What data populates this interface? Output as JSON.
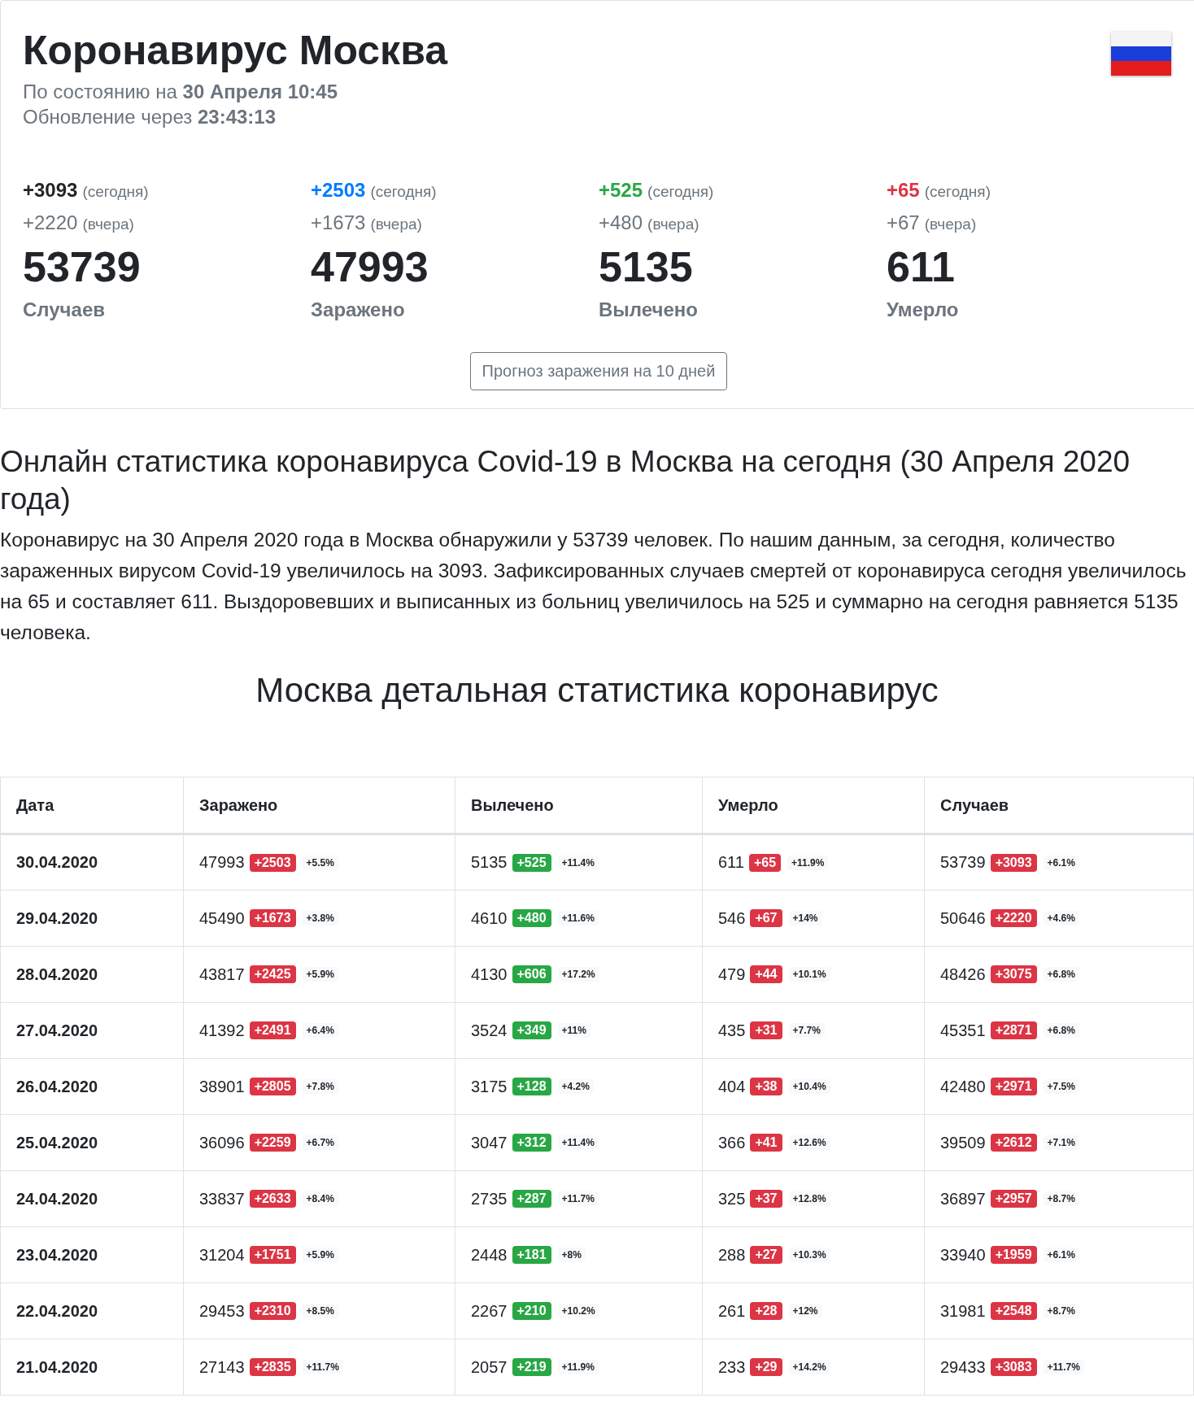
{
  "header": {
    "title": "Коронавирус Москва",
    "status": "По состоянию на **30 Апреля 10:45**",
    "update": "Обновление через **23:43:13**"
  },
  "counters": [
    {
      "today": "+3093",
      "today_note": "(сегодня)",
      "color": "#212529",
      "yesterday": "+2220",
      "yesterday_note": "(вчера)",
      "total": "53739",
      "label": "Случаев"
    },
    {
      "today": "+2503",
      "today_note": "(сегодня)",
      "color": "#007bff",
      "yesterday": "+1673",
      "yesterday_note": "(вчера)",
      "total": "47993",
      "label": "Заражено"
    },
    {
      "today": "+525",
      "today_note": "(сегодня)",
      "color": "#28a745",
      "yesterday": "+480",
      "yesterday_note": "(вчера)",
      "total": "5135",
      "label": "Вылечено"
    },
    {
      "today": "+65",
      "today_note": "(сегодня)",
      "color": "#dc3545",
      "yesterday": "+67",
      "yesterday_note": "(вчера)",
      "total": "611",
      "label": "Умерло"
    }
  ],
  "forecast_button": "Прогноз заражения на 10 дней",
  "article": {
    "heading": "Онлайн статистика коронавируса Covid-19 в Москва на сегодня (30 Апреля 2020 года)",
    "text": "Коронавирус на 30 Апреля 2020 года в Москва обнаружили у 53739 человек. По нашим данным, за сегодня, количество зараженных вирусом Covid-19 увеличилось на 3093. Зафиксированных случаев смертей от коронавируса сегодня увеличилось на 65 и составляет 611. Выздоровевших и выписанных из больниц увеличилось на 525 и суммарно на сегодня равняется 5135 человека."
  },
  "table_title": "Москва детальная статистика коронавирус",
  "table": {
    "columns": [
      "Дата",
      "Заражено",
      "Вылечено",
      "Умерло",
      "Случаев"
    ],
    "rows": [
      {
        "cells": [
          {
            "value": "30.04.2020"
          },
          {
            "value": "47993",
            "delta": "+2503",
            "color": "#dc3545",
            "pct": "+5.5%"
          },
          {
            "value": "5135",
            "delta": "+525",
            "color": "#28a745",
            "pct": "+11.4%"
          },
          {
            "value": "611",
            "delta": "+65",
            "color": "#dc3545",
            "pct": "+11.9%"
          },
          {
            "value": "53739",
            "delta": "+3093",
            "color": "#dc3545",
            "pct": "+6.1%"
          }
        ]
      },
      {
        "cells": [
          {
            "value": "29.04.2020"
          },
          {
            "value": "45490",
            "delta": "+1673",
            "color": "#dc3545",
            "pct": "+3.8%"
          },
          {
            "value": "4610",
            "delta": "+480",
            "color": "#28a745",
            "pct": "+11.6%"
          },
          {
            "value": "546",
            "delta": "+67",
            "color": "#dc3545",
            "pct": "+14%"
          },
          {
            "value": "50646",
            "delta": "+2220",
            "color": "#dc3545",
            "pct": "+4.6%"
          }
        ]
      },
      {
        "cells": [
          {
            "value": "28.04.2020"
          },
          {
            "value": "43817",
            "delta": "+2425",
            "color": "#dc3545",
            "pct": "+5.9%"
          },
          {
            "value": "4130",
            "delta": "+606",
            "color": "#28a745",
            "pct": "+17.2%"
          },
          {
            "value": "479",
            "delta": "+44",
            "color": "#dc3545",
            "pct": "+10.1%"
          },
          {
            "value": "48426",
            "delta": "+3075",
            "color": "#dc3545",
            "pct": "+6.8%"
          }
        ]
      },
      {
        "cells": [
          {
            "value": "27.04.2020"
          },
          {
            "value": "41392",
            "delta": "+2491",
            "color": "#dc3545",
            "pct": "+6.4%"
          },
          {
            "value": "3524",
            "delta": "+349",
            "color": "#28a745",
            "pct": "+11%"
          },
          {
            "value": "435",
            "delta": "+31",
            "color": "#dc3545",
            "pct": "+7.7%"
          },
          {
            "value": "45351",
            "delta": "+2871",
            "color": "#dc3545",
            "pct": "+6.8%"
          }
        ]
      },
      {
        "cells": [
          {
            "value": "26.04.2020"
          },
          {
            "value": "38901",
            "delta": "+2805",
            "color": "#dc3545",
            "pct": "+7.8%"
          },
          {
            "value": "3175",
            "delta": "+128",
            "color": "#28a745",
            "pct": "+4.2%"
          },
          {
            "value": "404",
            "delta": "+38",
            "color": "#dc3545",
            "pct": "+10.4%"
          },
          {
            "value": "42480",
            "delta": "+2971",
            "color": "#dc3545",
            "pct": "+7.5%"
          }
        ]
      },
      {
        "cells": [
          {
            "value": "25.04.2020"
          },
          {
            "value": "36096",
            "delta": "+2259",
            "color": "#dc3545",
            "pct": "+6.7%"
          },
          {
            "value": "3047",
            "delta": "+312",
            "color": "#28a745",
            "pct": "+11.4%"
          },
          {
            "value": "366",
            "delta": "+41",
            "color": "#dc3545",
            "pct": "+12.6%"
          },
          {
            "value": "39509",
            "delta": "+2612",
            "color": "#dc3545",
            "pct": "+7.1%"
          }
        ]
      },
      {
        "cells": [
          {
            "value": "24.04.2020"
          },
          {
            "value": "33837",
            "delta": "+2633",
            "color": "#dc3545",
            "pct": "+8.4%"
          },
          {
            "value": "2735",
            "delta": "+287",
            "color": "#28a745",
            "pct": "+11.7%"
          },
          {
            "value": "325",
            "delta": "+37",
            "color": "#dc3545",
            "pct": "+12.8%"
          },
          {
            "value": "36897",
            "delta": "+2957",
            "color": "#dc3545",
            "pct": "+8.7%"
          }
        ]
      },
      {
        "cells": [
          {
            "value": "23.04.2020"
          },
          {
            "value": "31204",
            "delta": "+1751",
            "color": "#dc3545",
            "pct": "+5.9%"
          },
          {
            "value": "2448",
            "delta": "+181",
            "color": "#28a745",
            "pct": "+8%"
          },
          {
            "value": "288",
            "delta": "+27",
            "color": "#dc3545",
            "pct": "+10.3%"
          },
          {
            "value": "33940",
            "delta": "+1959",
            "color": "#dc3545",
            "pct": "+6.1%"
          }
        ]
      },
      {
        "cells": [
          {
            "value": "22.04.2020"
          },
          {
            "value": "29453",
            "delta": "+2310",
            "color": "#dc3545",
            "pct": "+8.5%"
          },
          {
            "value": "2267",
            "delta": "+210",
            "color": "#28a745",
            "pct": "+10.2%"
          },
          {
            "value": "261",
            "delta": "+28",
            "color": "#dc3545",
            "pct": "+12%"
          },
          {
            "value": "31981",
            "delta": "+2548",
            "color": "#dc3545",
            "pct": "+8.7%"
          }
        ]
      },
      {
        "cells": [
          {
            "value": "21.04.2020"
          },
          {
            "value": "27143",
            "delta": "+2835",
            "color": "#dc3545",
            "pct": "+11.7%"
          },
          {
            "value": "2057",
            "delta": "+219",
            "color": "#28a745",
            "pct": "+11.9%"
          },
          {
            "value": "233",
            "delta": "+29",
            "color": "#dc3545",
            "pct": "+14.2%"
          },
          {
            "value": "29433",
            "delta": "+3083",
            "color": "#dc3545",
            "pct": "+11.7%"
          }
        ]
      }
    ]
  }
}
